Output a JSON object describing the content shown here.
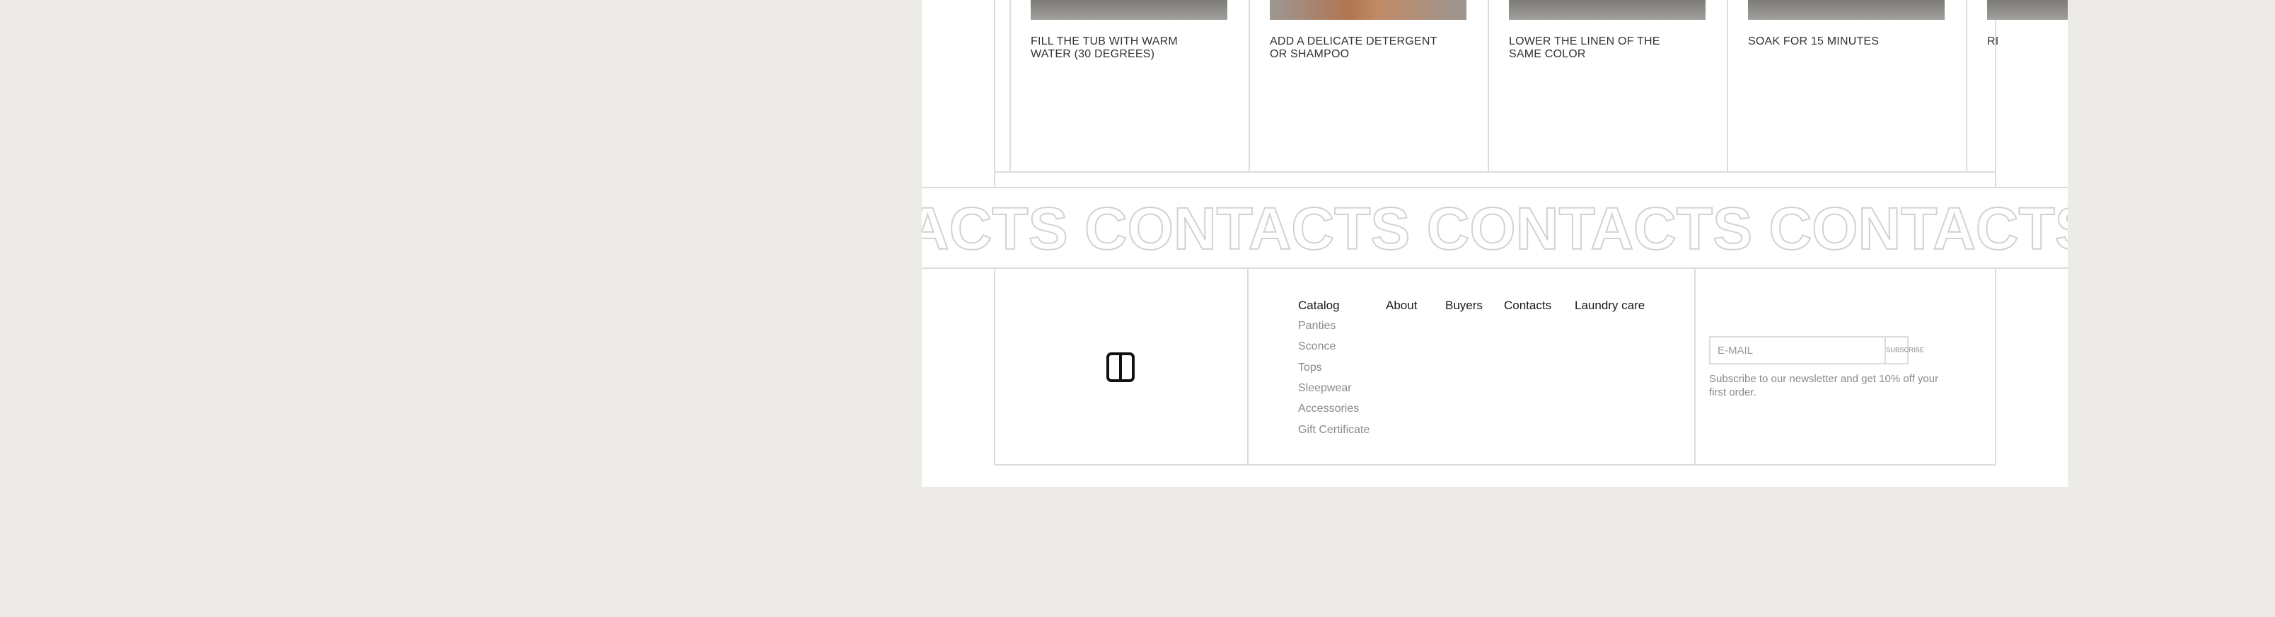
{
  "steps": [
    {
      "text": "FILL THE TUB WITH WARM WATER (30 DEGREES)"
    },
    {
      "text": "ADD A DELICATE DETERGENT OR SHAMPOO"
    },
    {
      "text": "LOWER THE LINEN OF THE SAME COLOR"
    },
    {
      "text": "SOAK FOR 15 MINUTES"
    },
    {
      "text": "RI"
    }
  ],
  "marquee": {
    "text": "ACTS CONTACTS CONTACTS CONTACTS CONTACTS"
  },
  "footer": {
    "nav": [
      {
        "label": "Catalog"
      },
      {
        "label": "About"
      },
      {
        "label": "Buyers"
      },
      {
        "label": "Contacts"
      },
      {
        "label": "Laundry care"
      }
    ],
    "catalog_items": [
      {
        "label": "Panties"
      },
      {
        "label": "Sconce"
      },
      {
        "label": "Tops"
      },
      {
        "label": "Sleepwear"
      },
      {
        "label": "Accessories"
      },
      {
        "label": "Gift Certificate"
      }
    ],
    "newsletter": {
      "placeholder": "E-MAIL",
      "button": "SUBSCRIBE",
      "text": "Subscribe to our newsletter and get 10% off your first order."
    }
  },
  "colors": {
    "background": "#ECEBE8",
    "surface": "#FFFFFF",
    "line": "#DCDCDC",
    "muted_text": "#8A8A8A"
  }
}
